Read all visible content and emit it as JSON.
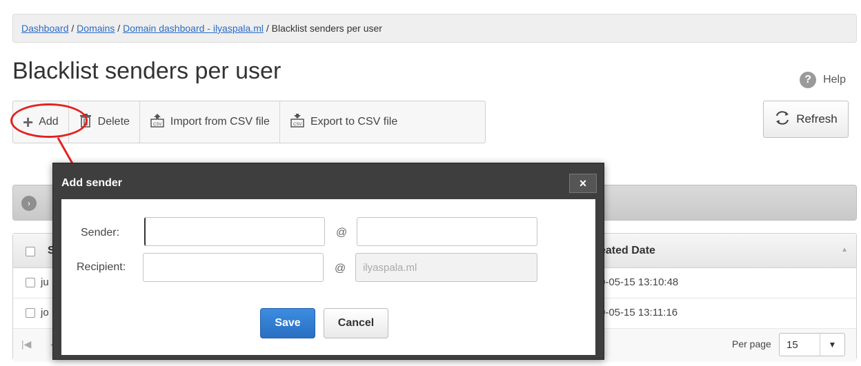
{
  "breadcrumb": {
    "items": [
      "Dashboard",
      "Domains",
      "Domain dashboard - ilyaspala.ml"
    ],
    "separator": " / ",
    "current": "Blacklist senders per user"
  },
  "page": {
    "title": "Blacklist senders per user",
    "help_label": "Help",
    "refresh_label": "Refresh"
  },
  "toolbar": {
    "add_label": "Add",
    "delete_label": "Delete",
    "import_label": "Import from CSV file",
    "export_label": "Export to CSV file"
  },
  "grid": {
    "header_col1_partial": "S",
    "header_date_partial": "eated Date",
    "rows": [
      {
        "name_partial": "ju",
        "date_partial": "0-05-15 13:10:48"
      },
      {
        "name_partial": "jo",
        "date_partial": "0-05-15 13:11:16"
      }
    ],
    "per_page_label": "Per page",
    "per_page_value": "15"
  },
  "modal": {
    "title": "Add sender",
    "close_glyph": "×",
    "sender_label": "Sender:",
    "recipient_label": "Recipient:",
    "at_symbol": "@",
    "recipient_domain_value": "ilyaspala.ml",
    "save_label": "Save",
    "cancel_label": "Cancel"
  },
  "colors": {
    "link": "#2a6cc5",
    "annotation": "#e42222",
    "save_button": "#2a6fc2",
    "modal_frame": "#3e3e3e"
  },
  "icons": {
    "add": "plus-icon",
    "delete": "trash-icon",
    "import": "csv-upload-icon",
    "export": "csv-download-icon",
    "refresh": "refresh-icon",
    "help": "help-icon",
    "close": "close-icon"
  }
}
